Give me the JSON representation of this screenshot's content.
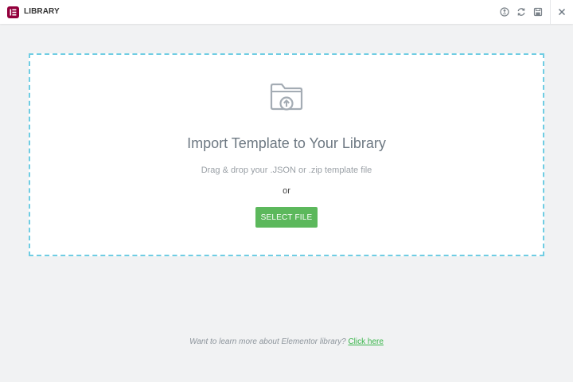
{
  "header": {
    "title": "LIBRARY",
    "icons": [
      "info-icon",
      "sync-icon",
      "save-icon",
      "close-icon"
    ]
  },
  "main": {
    "heading": "Import Template to Your Library",
    "instruction": "Drag & drop your .JSON or .zip template file",
    "separator": "or",
    "select_button": "SELECT FILE"
  },
  "footer": {
    "question": "Want to learn more about Elementor library?",
    "link_label": "Click here"
  },
  "colors": {
    "brand": "#93003c",
    "accent_green": "#5cb85c",
    "link_green": "#39b54a",
    "dropzone_border": "#6fcde3"
  }
}
